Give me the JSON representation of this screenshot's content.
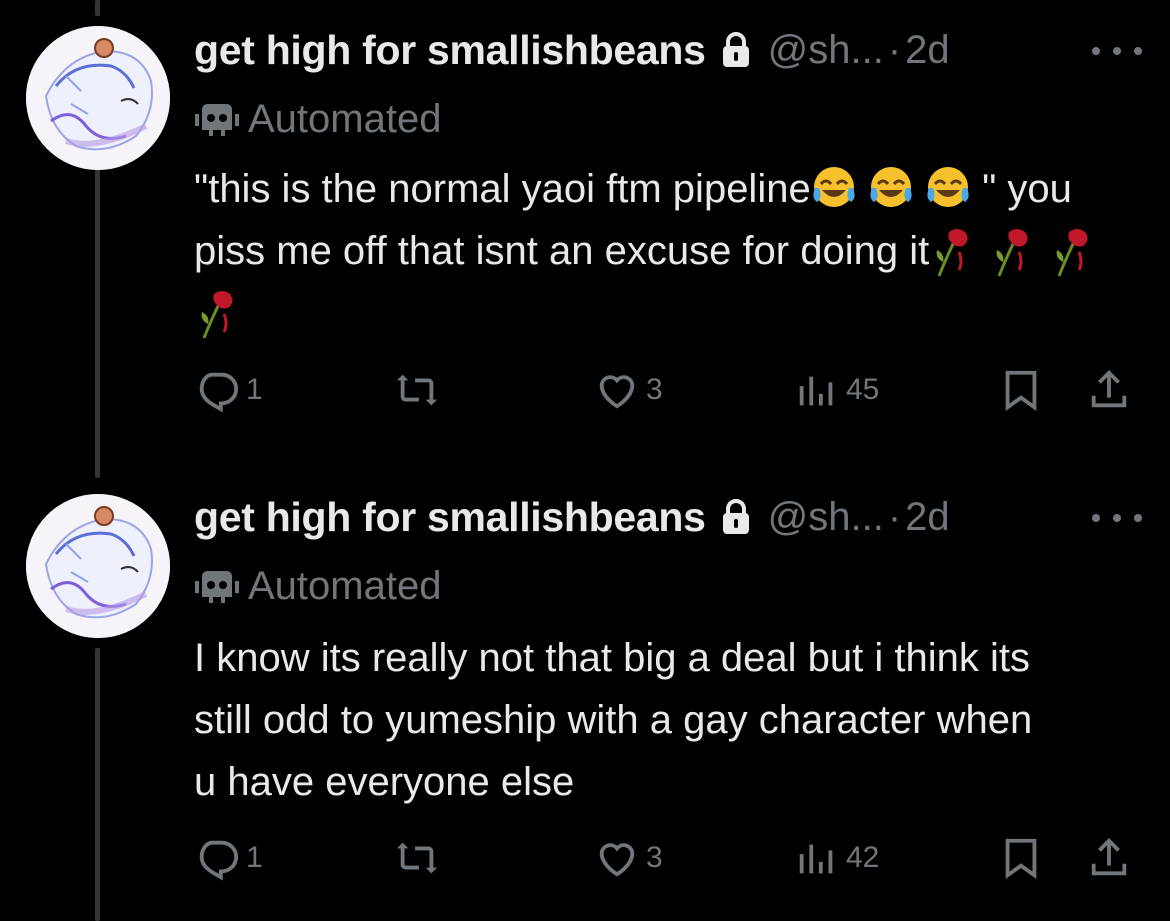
{
  "tweets": [
    {
      "display_name": "get high for smallishbeans",
      "handle": "@sh...",
      "separator": "·",
      "time": "2d",
      "label": "Automated",
      "text_parts": [
        "\"this is the normal yaoi ftm pipeline",
        "\" you piss me off that isnt an excuse for doing it"
      ],
      "emoji": [
        "face-with-tears-of-joy",
        "wilted-flower"
      ],
      "replies": "1",
      "likes": "3",
      "views": "45"
    },
    {
      "display_name": "get high for smallishbeans",
      "handle": "@sh...",
      "separator": "·",
      "time": "2d",
      "label": "Automated",
      "text": "I know its really not that big a deal but i think its still odd to yumeship with a gay character when u have everyone else",
      "replies": "1",
      "likes": "3",
      "views": "42"
    }
  ],
  "colors": {
    "background": "#000000",
    "text": "#e7e9ea",
    "muted": "#71767b",
    "thread_line": "#333639"
  },
  "icons": [
    "lock-icon",
    "bot-icon",
    "more-icon",
    "reply-icon",
    "retweet-icon",
    "like-icon",
    "views-icon",
    "bookmark-icon",
    "share-icon"
  ]
}
